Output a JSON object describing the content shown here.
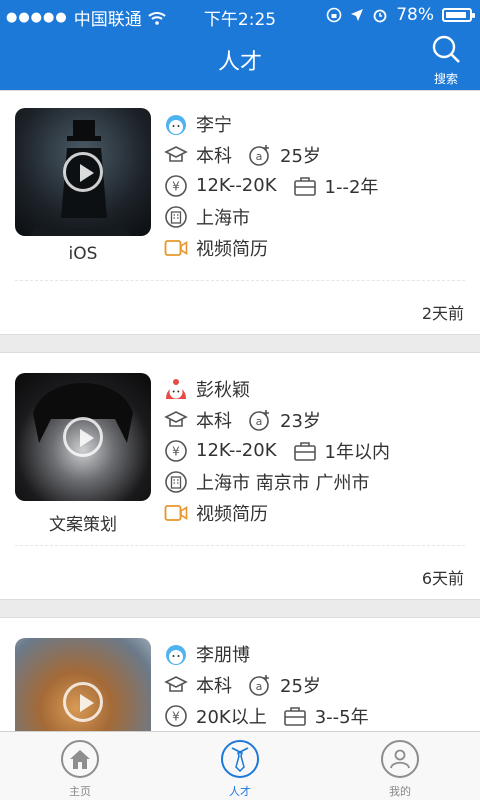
{
  "status_bar": {
    "carrier": "中国联通",
    "time": "下午2:25",
    "battery": "78%"
  },
  "header": {
    "title": "人才",
    "search_label": "搜索"
  },
  "candidates": [
    {
      "name": "李宁",
      "gender_icon": "boy-avatar-icon",
      "education": "本科",
      "age": "25岁",
      "salary": "12K--20K",
      "experience": "1--2年",
      "location": "上海市",
      "video_resume": "视频简历",
      "job": "iOS",
      "posted": "2天前"
    },
    {
      "name": "彭秋颖",
      "gender_icon": "girl-avatar-icon",
      "education": "本科",
      "age": "23岁",
      "salary": "12K--20K",
      "experience": "1年以内",
      "location": "上海市 南京市 广州市",
      "video_resume": "视频简历",
      "job": "文案策划",
      "posted": "6天前"
    },
    {
      "name": "李朋博",
      "gender_icon": "boy-avatar-icon",
      "education": "本科",
      "age": "25岁",
      "salary": "20K以上",
      "experience": "3--5年"
    }
  ],
  "nav": {
    "home": "主页",
    "talent": "人才",
    "mine": "我的"
  },
  "colors": {
    "brand_blue": "#1d79d8",
    "accent_orange": "#e8962b"
  }
}
